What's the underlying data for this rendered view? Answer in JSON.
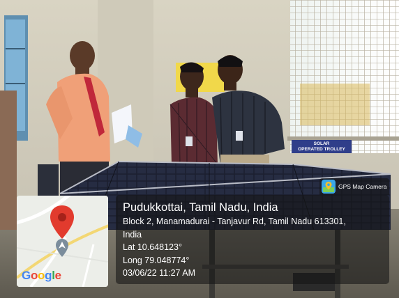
{
  "app": {
    "name": "GPS Map Camera",
    "icon": "gps-map-camera-icon"
  },
  "location": {
    "title": "Pudukkottai, Tamil Nadu, India",
    "address_line1": "Block 2, Manamadurai - Tanjavur Rd, Tamil Nadu 613301,",
    "address_line2": "India",
    "latitude": "Lat 10.648123°",
    "longitude": "Long 79.048774°",
    "datetime": "03/06/22 11:27 AM"
  },
  "map": {
    "provider": "Google",
    "marker_icon": "map-pin-icon",
    "marker_color": "#e23b2e"
  },
  "scene_sign": {
    "line1": "SOLAR",
    "line2": "OPERATED TROLLEY"
  },
  "colors": {
    "overlay": "#141414",
    "google_blue": "#4285f4",
    "google_red": "#ea4335",
    "google_yellow": "#fbbc05",
    "google_green": "#34a853"
  }
}
